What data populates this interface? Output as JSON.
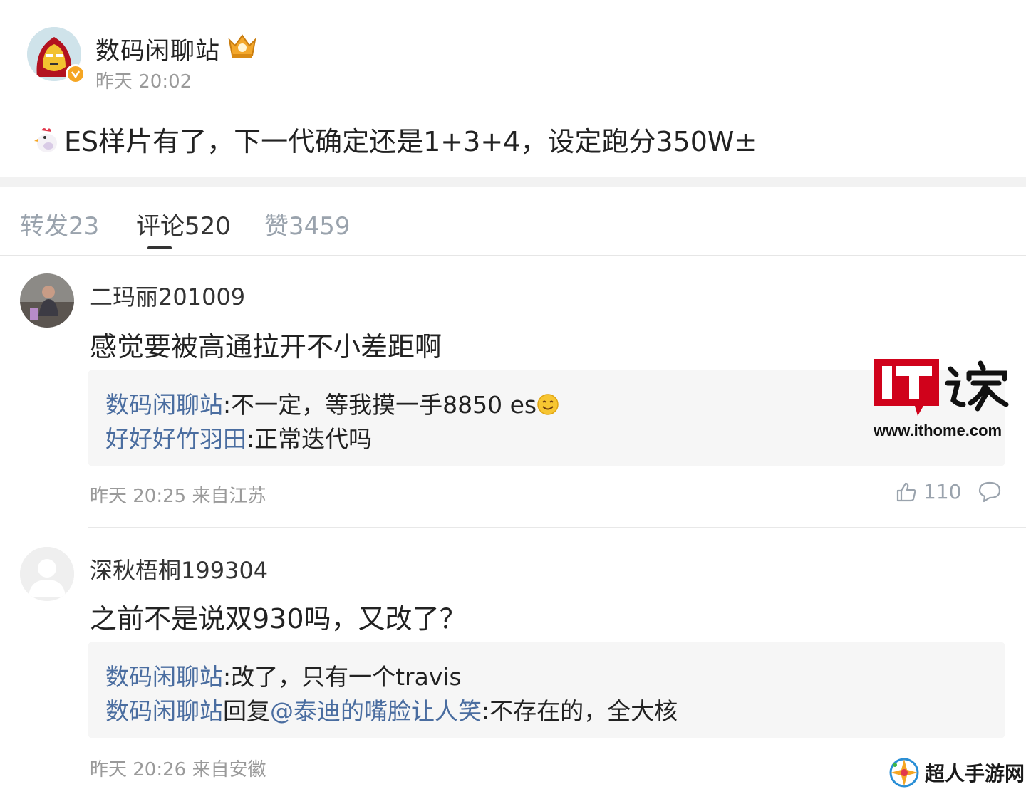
{
  "post": {
    "author": "数码闲聊站",
    "time": "昨天 20:02",
    "text": "ES样片有了，下一代确定还是1+3+4，设定跑分350W±"
  },
  "tabs": [
    {
      "label": "转发23",
      "active": false
    },
    {
      "label": "评论520",
      "active": true
    },
    {
      "label": "赞3459",
      "active": false
    }
  ],
  "comments": [
    {
      "user": "二玛丽201009",
      "text": "感觉要被高通拉开不小差距啊",
      "replies": [
        {
          "user": "数码闲聊站",
          "content": ":不一定，等我摸一手8850 es"
        },
        {
          "user": "好好好竹羽田",
          "content": ":正常迭代吗"
        }
      ],
      "meta": "昨天 20:25 来自江苏",
      "likes": "110"
    },
    {
      "user": "深秋梧桐199304",
      "text": "之前不是说双930吗，又改了？",
      "replies": [
        {
          "user": "数码闲聊站",
          "content": ":改了，只有一个travis"
        },
        {
          "user": "数码闲聊站",
          "mid": "回复",
          "mention": "@泰迪的嘴脸让人笑",
          "content": ":不存在的，全大核"
        }
      ],
      "meta": "昨天 20:26 来自安徽"
    }
  ],
  "watermarks": {
    "ithome_logo_text": "IT之家",
    "ithome_url": "www.ithome.com",
    "game_site": "超人手游网"
  },
  "colors": {
    "link": "#4a6da0",
    "muted": "#9a9a9a",
    "ithome_red": "#d0021b"
  }
}
